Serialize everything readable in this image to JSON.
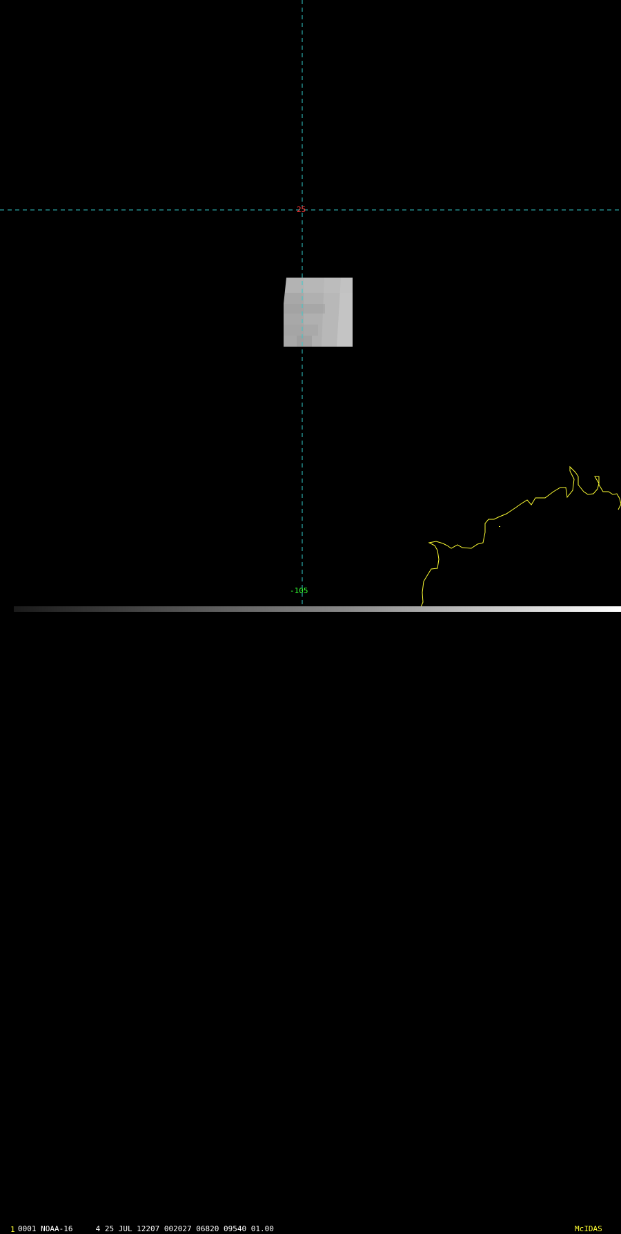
{
  "map": {
    "latitude_line_label": "25",
    "longitude_line_label": "-105",
    "grid_color": "#33cccc",
    "lat_label_color": "#ff3333",
    "lon_label_color": "#33ff33",
    "coastline_color": "#ffff33"
  },
  "status_bar": {
    "frame_number": "1",
    "frame_number_color": "#ffff33",
    "text": "0001 NOAA-16     4 25 JUL 12207 002027 06820 09540 01.00",
    "brand": "McIDAS",
    "brand_color": "#ffff33"
  }
}
